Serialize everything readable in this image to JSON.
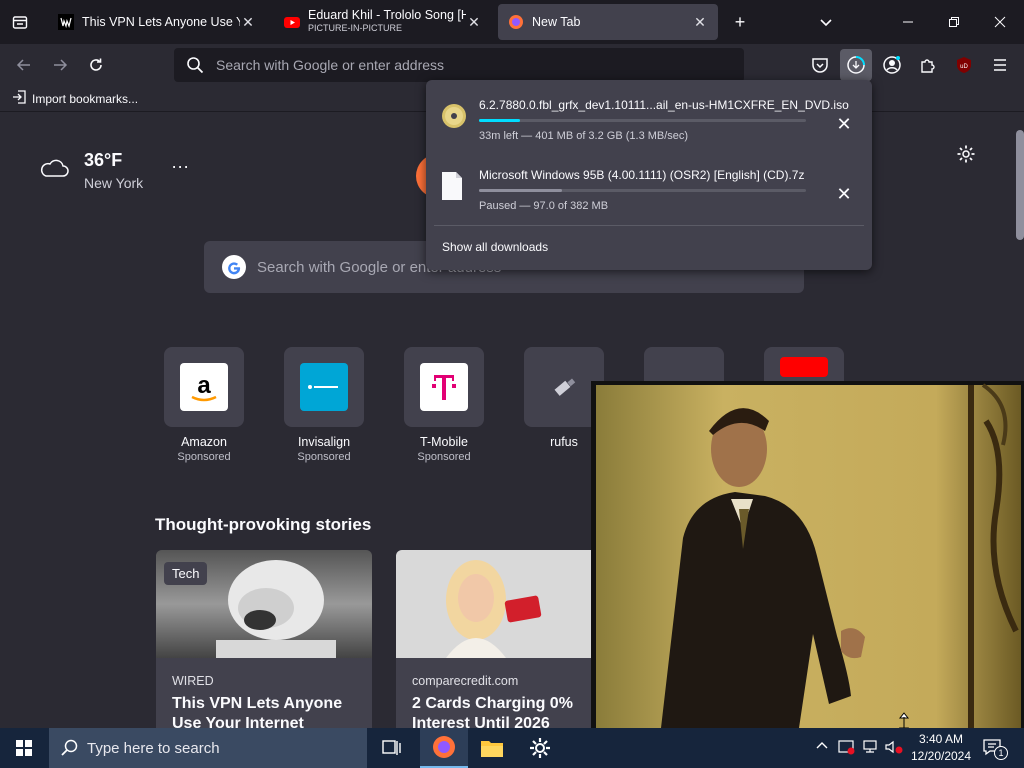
{
  "tabs": [
    {
      "title": "This VPN Lets Anyone Use Your Internet",
      "subtitle": ""
    },
    {
      "title": "Eduard Khil - Trololo Song [HD]",
      "subtitle": "PICTURE-IN-PICTURE"
    },
    {
      "title": "New Tab",
      "subtitle": ""
    }
  ],
  "toolbar": {
    "url_placeholder": "Search with Google or enter address"
  },
  "bookmarks": {
    "import_label": "Import bookmarks..."
  },
  "weather": {
    "temp": "36°F",
    "city": "New York"
  },
  "search": {
    "placeholder": "Search with Google or enter address"
  },
  "shortcuts": [
    {
      "name": "Amazon",
      "sponsored": "Sponsored"
    },
    {
      "name": "Invisalign",
      "sponsored": "Sponsored"
    },
    {
      "name": "T-Mobile",
      "sponsored": "Sponsored"
    },
    {
      "name": "rufus",
      "sponsored": ""
    }
  ],
  "stories": {
    "title": "Thought-provoking stories",
    "items": [
      {
        "badge": "Tech",
        "source": "WIRED",
        "headline": "This VPN Lets Anyone Use Your Internet"
      },
      {
        "badge": "",
        "source": "comparecredit.com",
        "headline": "2 Cards Charging 0% Interest Until 2026"
      }
    ]
  },
  "downloads": {
    "items": [
      {
        "file": "6.2.7880.0.fbl_grfx_dev1.10111...ail_en-us-HM1CXFRE_EN_DVD.iso",
        "status": "33m left — 401 MB of 3.2 GB (1.3 MB/sec)",
        "progress": 0.125,
        "paused": false
      },
      {
        "file": "Microsoft Windows 95B (4.00.1111) (OSR2) [English] (CD).7z",
        "status": "Paused — 97.0 of 382 MB",
        "progress": 0.254,
        "paused": true
      }
    ],
    "show_all": "Show all downloads"
  },
  "taskbar": {
    "search_placeholder": "Type here to search",
    "time": "3:40 AM",
    "date": "12/20/2024",
    "notification_count": "1"
  },
  "colors": {
    "accent": "#00ddff",
    "tab_bg": "#1c1b22",
    "toolbar_bg": "#2b2a33",
    "taskbar_bg": "#16253c"
  }
}
